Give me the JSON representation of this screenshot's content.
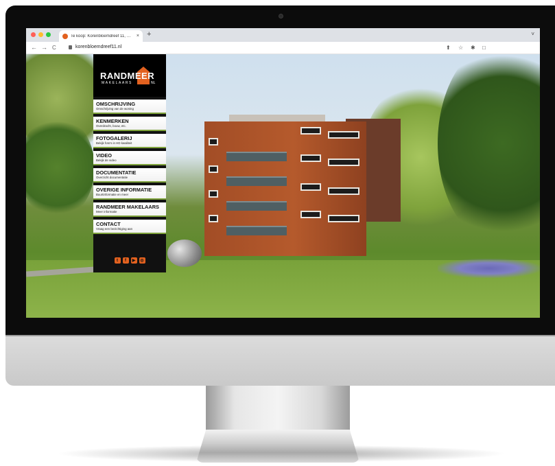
{
  "browser": {
    "tab_title": "Te koop: Korenbloemdreef 11, …",
    "tab_close": "×",
    "new_tab": "+",
    "tab_menu": "˅",
    "url": "korenbloemdreef11.nl",
    "nav": {
      "back": "←",
      "forward": "→",
      "reload": "C"
    },
    "toolbar_icons": {
      "share": "⬆",
      "bookmark": "☆",
      "extensions": "✱",
      "sidebar": "□"
    }
  },
  "site": {
    "logo": {
      "name": "RANDMEER",
      "sub": "MAKELAARS",
      "suffix": "NL"
    },
    "menu": [
      {
        "title": "OMSCHRIJVING",
        "subtitle": "Omschrijving van de woning"
      },
      {
        "title": "KENMERKEN",
        "subtitle": "Overdracht, bouw, etc."
      },
      {
        "title": "FOTOGALERIJ",
        "subtitle": "Bekijk foto's in HD kwaliteit"
      },
      {
        "title": "VIDEO",
        "subtitle": "Bekijk de video"
      },
      {
        "title": "DOCUMENTATIE",
        "subtitle": "Overzicht documentatie"
      },
      {
        "title": "OVERIGE INFORMATIE",
        "subtitle": "Buurtinformatie en meer"
      },
      {
        "title": "RANDMEER MAKELAARS",
        "subtitle": "Meer informatie"
      },
      {
        "title": "CONTACT",
        "subtitle": "Vraag een bezichtiging aan"
      }
    ],
    "social": [
      {
        "icon": "twitter-icon",
        "glyph": "t"
      },
      {
        "icon": "facebook-icon",
        "glyph": "f"
      },
      {
        "icon": "youtube-icon",
        "glyph": "▶"
      },
      {
        "icon": "instagram-icon",
        "glyph": "◎"
      }
    ],
    "accent": "#e2611f",
    "menu_underline": "#7ea23b"
  }
}
